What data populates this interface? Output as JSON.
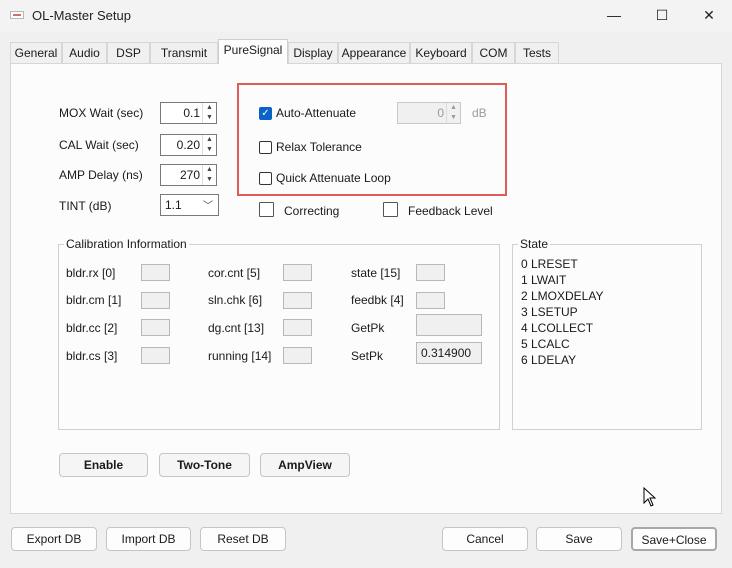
{
  "window": {
    "title": "OL-Master Setup",
    "minimize": "—",
    "maximize": "☐",
    "close": "✕"
  },
  "tabs": [
    "General",
    "Audio",
    "DSP",
    "Transmit",
    "PureSignal",
    "Display",
    "Appearance",
    "Keyboard",
    "COM",
    "Tests"
  ],
  "active_tab": "PureSignal",
  "timing": {
    "mox_wait": {
      "label": "MOX Wait (sec)",
      "value": "0.1"
    },
    "cal_wait": {
      "label": "CAL Wait (sec)",
      "value": "0.20"
    },
    "amp_delay": {
      "label": "AMP Delay (ns)",
      "value": "270"
    },
    "tint": {
      "label": "TINT (dB)",
      "value": "1.1"
    }
  },
  "options": {
    "auto_attenuate": {
      "label": "Auto-Attenuate",
      "checked": true,
      "value": "0",
      "unit": "dB"
    },
    "relax_tolerance": {
      "label": "Relax Tolerance",
      "checked": false
    },
    "quick_attenuate_loop": {
      "label": "Quick Attenuate Loop",
      "checked": false
    },
    "correcting": {
      "label": "Correcting",
      "checked": false
    },
    "feedback_level": {
      "label": "Feedback Level",
      "checked": false
    }
  },
  "calibration": {
    "title": "Calibration Information",
    "col1": [
      "bldr.rx [0]",
      "bldr.cm [1]",
      "bldr.cc [2]",
      "bldr.cs [3]"
    ],
    "col2": [
      "cor.cnt [5]",
      "sln.chk [6]",
      "dg.cnt [13]",
      "running [14]"
    ],
    "col3": [
      "state [15]",
      "feedbk [4]",
      "GetPk",
      "SetPk"
    ],
    "setpk_value": "0.314900"
  },
  "state": {
    "title": "State",
    "items": [
      "0  LRESET",
      "1  LWAIT",
      "2  LMOXDELAY",
      "3  LSETUP",
      "4  LCOLLECT",
      "5  LCALC",
      "6  LDELAY"
    ]
  },
  "actions": {
    "enable": "Enable",
    "two_tone": "Two-Tone",
    "ampview": "AmpView"
  },
  "footer": {
    "export_db": "Export DB",
    "import_db": "Import DB",
    "reset_db": "Reset DB",
    "cancel": "Cancel",
    "save": "Save",
    "save_close": "Save+Close"
  }
}
